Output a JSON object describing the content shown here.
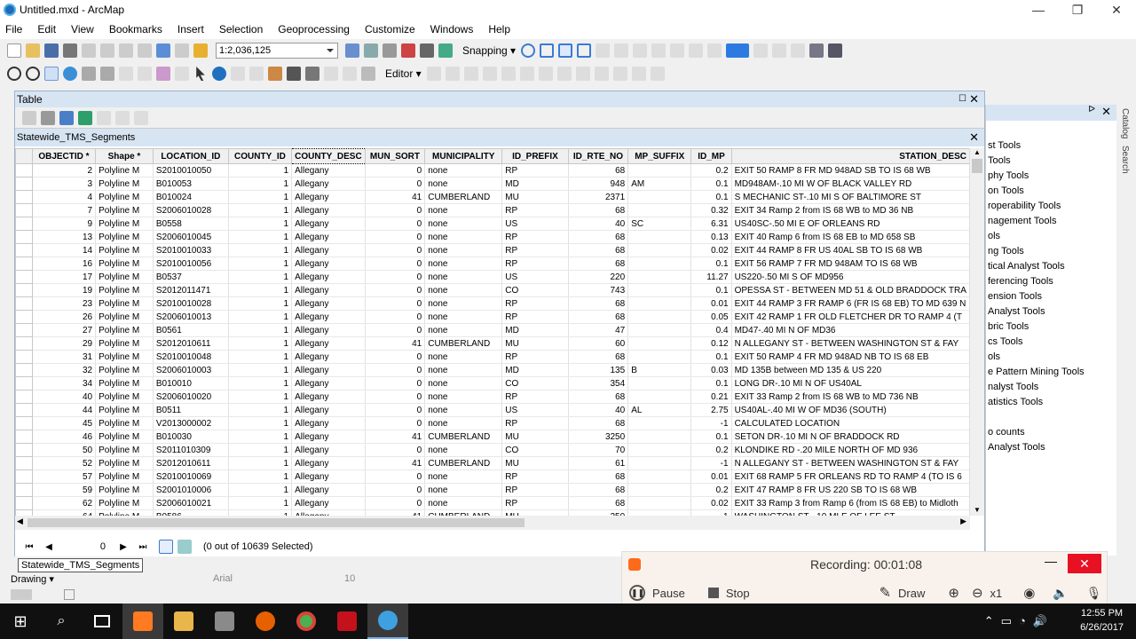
{
  "window": {
    "title": "Untitled.mxd - ArcMap"
  },
  "menu": [
    "File",
    "Edit",
    "View",
    "Bookmarks",
    "Insert",
    "Selection",
    "Geoprocessing",
    "Customize",
    "Windows",
    "Help"
  ],
  "toolbar": {
    "scale": "1:2,036,125",
    "snapping": "Snapping ▾",
    "editor": "Editor ▾"
  },
  "table_window": {
    "title": "Table",
    "layer_tab": "Statewide_TMS_Segments"
  },
  "columns": [
    "OBJECTID *",
    "Shape *",
    "LOCATION_ID",
    "COUNTY_ID",
    "COUNTY_DESC",
    "MUN_SORT",
    "MUNICIPALITY",
    "ID_PREFIX",
    "ID_RTE_NO",
    "MP_SUFFIX",
    "ID_MP",
    "STATION_DESC"
  ],
  "rows": [
    [
      "2",
      "Polyline M",
      "S2010010050",
      "1",
      "Allegany",
      "0",
      "none",
      "RP",
      "68",
      "",
      "0.2",
      "EXIT 50 RAMP 8 FR MD 948AD SB TO IS 68 WB"
    ],
    [
      "3",
      "Polyline M",
      "B010053",
      "1",
      "Allegany",
      "0",
      "none",
      "MD",
      "948",
      "AM",
      "0.1",
      "MD948AM-.10 MI W OF BLACK VALLEY RD"
    ],
    [
      "4",
      "Polyline M",
      "B010024",
      "1",
      "Allegany",
      "41",
      "CUMBERLAND",
      "MU",
      "2371",
      "",
      "0.1",
      "S MECHANIC ST-.10 MI S OF BALTIMORE ST"
    ],
    [
      "7",
      "Polyline M",
      "S2006010028",
      "1",
      "Allegany",
      "0",
      "none",
      "RP",
      "68",
      "",
      "0.32",
      "EXIT 34 Ramp 2 from IS 68 WB to MD 36 NB"
    ],
    [
      "9",
      "Polyline M",
      "B0558",
      "1",
      "Allegany",
      "0",
      "none",
      "US",
      "40",
      "SC",
      "6.31",
      "US40SC-.50 MI E OF ORLEANS RD"
    ],
    [
      "13",
      "Polyline M",
      "S2006010045",
      "1",
      "Allegany",
      "0",
      "none",
      "RP",
      "68",
      "",
      "0.13",
      "EXIT 40 Ramp 6 from IS 68 EB to MD 658 SB"
    ],
    [
      "14",
      "Polyline M",
      "S2010010033",
      "1",
      "Allegany",
      "0",
      "none",
      "RP",
      "68",
      "",
      "0.02",
      "EXIT 44 RAMP 8 FR US 40AL SB TO IS 68 WB"
    ],
    [
      "16",
      "Polyline M",
      "S2010010056",
      "1",
      "Allegany",
      "0",
      "none",
      "RP",
      "68",
      "",
      "0.1",
      "EXIT 56 RAMP 7 FR MD 948AM TO IS 68 WB"
    ],
    [
      "17",
      "Polyline M",
      "B0537",
      "1",
      "Allegany",
      "0",
      "none",
      "US",
      "220",
      "",
      "11.27",
      "US220-.50 MI S OF MD956"
    ],
    [
      "19",
      "Polyline M",
      "S2012011471",
      "1",
      "Allegany",
      "0",
      "none",
      "CO",
      "743",
      "",
      "0.1",
      "OPESSA ST - BETWEEN MD 51 & OLD BRADDOCK TRA"
    ],
    [
      "23",
      "Polyline M",
      "S2010010028",
      "1",
      "Allegany",
      "0",
      "none",
      "RP",
      "68",
      "",
      "0.01",
      "EXIT 44 RAMP 3 FR RAMP 6 (FR IS 68 EB) TO MD 639 N"
    ],
    [
      "26",
      "Polyline M",
      "S2006010013",
      "1",
      "Allegany",
      "0",
      "none",
      "RP",
      "68",
      "",
      "0.05",
      "EXIT 42 RAMP 1 FR OLD FLETCHER DR TO RAMP 4 (T"
    ],
    [
      "27",
      "Polyline M",
      "B0561",
      "1",
      "Allegany",
      "0",
      "none",
      "MD",
      "47",
      "",
      "0.4",
      "MD47-.40 MI N OF MD36"
    ],
    [
      "29",
      "Polyline M",
      "S2012010611",
      "1",
      "Allegany",
      "41",
      "CUMBERLAND",
      "MU",
      "60",
      "",
      "0.12",
      "N ALLEGANY ST - BETWEEN WASHINGTON ST & FAY"
    ],
    [
      "31",
      "Polyline M",
      "S2010010048",
      "1",
      "Allegany",
      "0",
      "none",
      "RP",
      "68",
      "",
      "0.1",
      "EXIT 50 RAMP 4 FR MD 948AD NB TO IS 68 EB"
    ],
    [
      "32",
      "Polyline M",
      "S2006010003",
      "1",
      "Allegany",
      "0",
      "none",
      "MD",
      "135",
      "B",
      "0.03",
      "MD 135B between MD 135 & US 220"
    ],
    [
      "34",
      "Polyline M",
      "B010010",
      "1",
      "Allegany",
      "0",
      "none",
      "CO",
      "354",
      "",
      "0.1",
      "LONG DR-.10 MI N OF US40AL"
    ],
    [
      "40",
      "Polyline M",
      "S2006010020",
      "1",
      "Allegany",
      "0",
      "none",
      "RP",
      "68",
      "",
      "0.21",
      "EXIT 33 Ramp 2 from IS 68 WB to MD 736 NB"
    ],
    [
      "44",
      "Polyline M",
      "B0511",
      "1",
      "Allegany",
      "0",
      "none",
      "US",
      "40",
      "AL",
      "2.75",
      "US40AL-.40 MI W OF MD36 (SOUTH)"
    ],
    [
      "45",
      "Polyline M",
      "V2013000002",
      "1",
      "Allegany",
      "0",
      "none",
      "RP",
      "68",
      "",
      "-1",
      "CALCULATED LOCATION"
    ],
    [
      "46",
      "Polyline M",
      "B010030",
      "1",
      "Allegany",
      "41",
      "CUMBERLAND",
      "MU",
      "3250",
      "",
      "0.1",
      "SETON DR-.10 MI N OF BRADDOCK RD"
    ],
    [
      "50",
      "Polyline M",
      "S2011010309",
      "1",
      "Allegany",
      "0",
      "none",
      "CO",
      "70",
      "",
      "0.2",
      "KLONDIKE RD -.20 MILE NORTH OF MD 936"
    ],
    [
      "52",
      "Polyline M",
      "S2012010611",
      "1",
      "Allegany",
      "41",
      "CUMBERLAND",
      "MU",
      "61",
      "",
      "-1",
      "N ALLEGANY ST - BETWEEN WASHINGTON ST & FAY"
    ],
    [
      "57",
      "Polyline M",
      "S2010010069",
      "1",
      "Allegany",
      "0",
      "none",
      "RP",
      "68",
      "",
      "0.01",
      "EXIT 68 RAMP 5 FR ORLEANS RD TO RAMP 4 (TO IS 6"
    ],
    [
      "59",
      "Polyline M",
      "S2001010006",
      "1",
      "Allegany",
      "0",
      "none",
      "RP",
      "68",
      "",
      "0.2",
      "EXIT 47 RAMP 8 FR US 220 SB TO IS 68 WB"
    ],
    [
      "62",
      "Polyline M",
      "S2006010021",
      "1",
      "Allegany",
      "0",
      "none",
      "RP",
      "68",
      "",
      "0.02",
      "EXIT 33 Ramp 3 from Ramp 6 (from IS 68 EB) to Midloth"
    ],
    [
      "64",
      "Polyline M",
      "B0586",
      "1",
      "Allegany",
      "41",
      "CUMBERLAND",
      "MU",
      "250",
      "",
      "-1",
      "WASHINGTON ST - 10 MI E OF LEE ST"
    ]
  ],
  "nav": {
    "record": "0",
    "selected": "(0 out of 10639 Selected)"
  },
  "bottom_tab": "Statewide_TMS_Segments",
  "toolbox_items": [
    "st Tools",
    "Tools",
    "phy Tools",
    "on Tools",
    "roperability Tools",
    "nagement Tools",
    "ols",
    "ng Tools",
    "tical Analyst Tools",
    "ferencing Tools",
    "ension Tools",
    "Analyst Tools",
    "bric Tools",
    "cs Tools",
    "ols",
    "e Pattern Mining Tools",
    "nalyst Tools",
    "atistics Tools",
    "",
    "o counts",
    "Analyst Tools"
  ],
  "side_tabs": [
    "Catalog",
    "Search"
  ],
  "recorder": {
    "status": "Recording:  00:01:08",
    "pause": "Pause",
    "stop": "Stop",
    "draw": "Draw",
    "zoom": "x1"
  },
  "drawing_label": "Drawing ▾",
  "font_name": "Arial",
  "font_size": "10",
  "clock": {
    "time": "12:55 PM",
    "date": "6/26/2017"
  }
}
